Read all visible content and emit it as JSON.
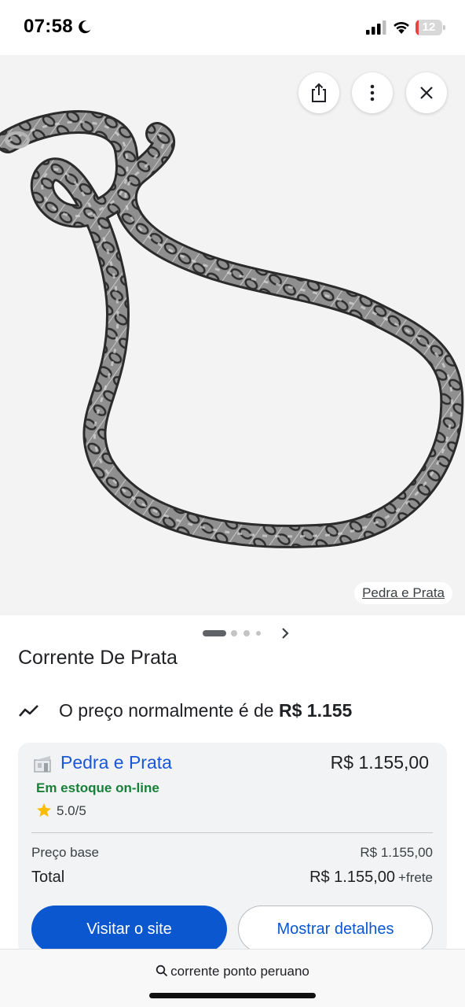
{
  "status_bar": {
    "time": "07:58",
    "battery_level": "12",
    "battery_fraction": 0.12,
    "icons": [
      "moon-icon",
      "signal-icon",
      "wifi-icon",
      "battery-icon"
    ]
  },
  "image_viewer": {
    "image_subject": "silver byzantine chain necklace",
    "actions": [
      "share-icon",
      "more-options-icon",
      "close-icon"
    ],
    "source_label": "Pedra e Prata",
    "pager": {
      "current_page": 1,
      "visible_dots": 4
    }
  },
  "product": {
    "title": "Corrente De Prata",
    "price_insight_text": "O preço normalmente é de ",
    "price_insight_value": "R$ 1.155"
  },
  "offer": {
    "store_name": "Pedra e Prata",
    "price": "R$ 1.155,00",
    "stock": "Em estoque on-line",
    "rating": "5.0/5",
    "base_label": "Preço base",
    "base_value": "R$ 1.155,00",
    "total_label": "Total",
    "total_value": "R$ 1.155,00",
    "shipping_note": "+frete",
    "visit_button": "Visitar o site",
    "details_button": "Mostrar detalhes"
  },
  "bottom_bar": {
    "search_query": "corrente ponto peruano"
  },
  "colors": {
    "link_blue": "#1a57d6",
    "primary_button": "#0b57d0",
    "stock_green": "#188038",
    "star_yellow": "#fbbc04",
    "battery_red": "#e5453b"
  }
}
